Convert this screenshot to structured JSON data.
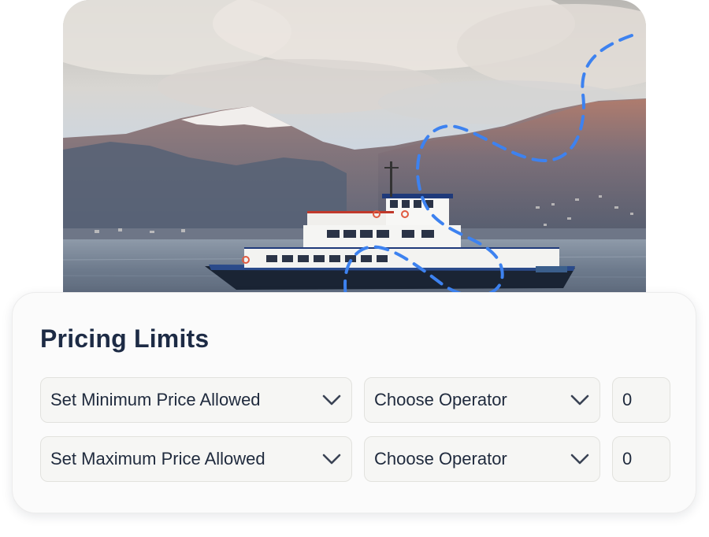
{
  "photo": {
    "alt": "Ferry boat on a lake with snowy mountains"
  },
  "pricing_limits": {
    "title": "Pricing Limits",
    "rows": [
      {
        "limit_select": "Set Minimum Price Allowed",
        "operator_select": "Choose Operator",
        "value": "0"
      },
      {
        "limit_select": "Set Maximum Price Allowed",
        "operator_select": "Choose Operator",
        "value": "0"
      }
    ]
  },
  "icons": {
    "dropdown": "chevron-down-icon"
  },
  "colors": {
    "title": "#1d2b45",
    "text": "#1f2a3d",
    "field_bg": "#f6f6f4",
    "field_border": "#e2e2de",
    "dashed_accent": "#3d82f0",
    "card_bg": "#fbfbfb"
  }
}
